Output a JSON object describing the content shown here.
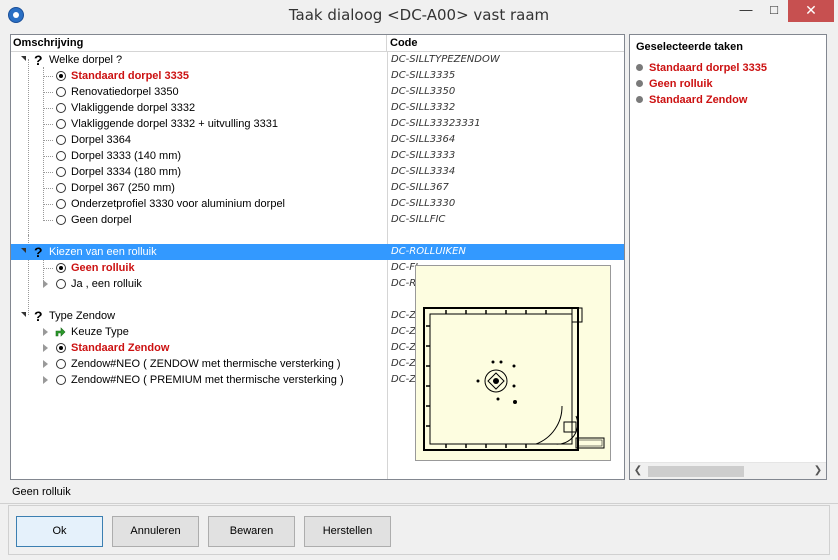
{
  "window": {
    "title": "Taak dialoog <DC-A00> vast raam",
    "minimize": "—",
    "maximize": "□",
    "close": "✕"
  },
  "tree": {
    "col_desc": "Omschrijving",
    "col_code": "Code",
    "rows": [
      {
        "label": "Welke dorpel ?",
        "code": "DC-SILLTYPEZENDOW",
        "kind": "question"
      },
      {
        "label": "Standaard dorpel 3335",
        "code": "DC-SILL3335",
        "kind": "radio",
        "checked": true
      },
      {
        "label": "Renovatiedorpel 3350",
        "code": "DC-SILL3350",
        "kind": "radio"
      },
      {
        "label": "Vlakliggende dorpel 3332",
        "code": "DC-SILL3332",
        "kind": "radio"
      },
      {
        "label": "Vlakliggende dorpel 3332 + uitvulling 3331",
        "code": "DC-SILL33323331",
        "kind": "radio"
      },
      {
        "label": "Dorpel 3364",
        "code": "DC-SILL3364",
        "kind": "radio"
      },
      {
        "label": "Dorpel 3333 (140 mm)",
        "code": "DC-SILL3333",
        "kind": "radio"
      },
      {
        "label": "Dorpel 3334 (180 mm)",
        "code": "DC-SILL3334",
        "kind": "radio"
      },
      {
        "label": "Dorpel 367 (250 mm)",
        "code": "DC-SILL367",
        "kind": "radio"
      },
      {
        "label": "Onderzetprofiel 3330 voor aluminium dorpel",
        "code": "DC-SILL3330",
        "kind": "radio"
      },
      {
        "label": "Geen dorpel",
        "code": "DC-SILLFIC",
        "kind": "radio"
      },
      {
        "label": "Kiezen van een rolluik",
        "code": "DC-ROLLUIKEN",
        "kind": "question",
        "selected": true
      },
      {
        "label": "Geen rolluik",
        "code": "DC-FI",
        "kind": "radio",
        "checked": true
      },
      {
        "label": "Ja , een rolluik",
        "code": "DC-R",
        "kind": "radio"
      },
      {
        "label": "Type Zendow",
        "code": "DC-Z",
        "kind": "question"
      },
      {
        "label": "Keuze Type",
        "code": "DC-Z",
        "kind": "task"
      },
      {
        "label": "Standaard Zendow",
        "code": "DC-Z",
        "kind": "radio",
        "checked": true
      },
      {
        "label": "Zendow#NEO ( ZENDOW met thermische versterking )",
        "code": "DC-Z",
        "kind": "radio"
      },
      {
        "label": "Zendow#NEO ( PREMIUM met thermische versterking )",
        "code": "DC-Z",
        "kind": "radio"
      }
    ]
  },
  "selected_tasks": {
    "title": "Geselecteerde taken",
    "items": [
      "Standaard dorpel 3335",
      "Geen rolluik",
      "Standaard Zendow"
    ]
  },
  "status": "Geen rolluik",
  "buttons": {
    "ok": "Ok",
    "cancel": "Annuleren",
    "save": "Bewaren",
    "restore": "Herstellen"
  },
  "colors": {
    "selection": "#3399ff",
    "accent_red": "#cc1111",
    "preview_bg": "#fdfde0"
  }
}
